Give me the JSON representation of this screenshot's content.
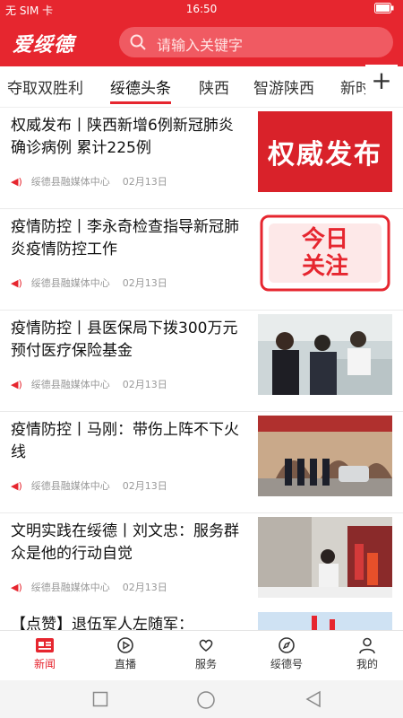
{
  "status_bar": {
    "carrier": "无 SIM 卡",
    "time": "16:50"
  },
  "header": {
    "logo": "爱绥德",
    "search_placeholder": "请输入关键字"
  },
  "tabs": [
    {
      "label": "夺取双胜利",
      "active": false
    },
    {
      "label": "绥德头条",
      "active": true
    },
    {
      "label": "陕西",
      "active": false
    },
    {
      "label": "智游陕西",
      "active": false
    },
    {
      "label": "新时",
      "active": false
    }
  ],
  "tab_add_label": "+",
  "news": [
    {
      "title": "权威发布丨陕西新增6例新冠肺炎确诊病例 累计225例",
      "source": "绥德县融媒体中心",
      "date": "02月13日",
      "thumb_text": "权威发布"
    },
    {
      "title": "疫情防控丨李永奇检查指导新冠肺炎疫情防控工作",
      "source": "绥德县融媒体中心",
      "date": "02月13日",
      "thumb_text_a": "今日",
      "thumb_text_b": "关注"
    },
    {
      "title": "疫情防控丨县医保局下拨300万元预付医疗保险基金",
      "source": "绥德县融媒体中心",
      "date": "02月13日"
    },
    {
      "title": "疫情防控丨马刚：带伤上阵不下火线",
      "source": "绥德县融媒体中心",
      "date": "02月13日"
    },
    {
      "title": "文明实践在绥德丨刘文忠：服务群众是他的行动自觉",
      "source": "绥德县融媒体中心",
      "date": "02月13日"
    }
  ],
  "partial_news": {
    "title": "【点赞】退伍军人左随军："
  },
  "bottom_nav": [
    {
      "label": "新闻",
      "icon": "news-icon",
      "active": true
    },
    {
      "label": "直播",
      "icon": "play-icon",
      "active": false
    },
    {
      "label": "服务",
      "icon": "heart-hand-icon",
      "active": false
    },
    {
      "label": "绥德号",
      "icon": "compass-icon",
      "active": false
    },
    {
      "label": "我的",
      "icon": "user-icon",
      "active": false
    }
  ],
  "colors": {
    "brand_red": "#e6262f",
    "meta_gray": "#999999"
  }
}
